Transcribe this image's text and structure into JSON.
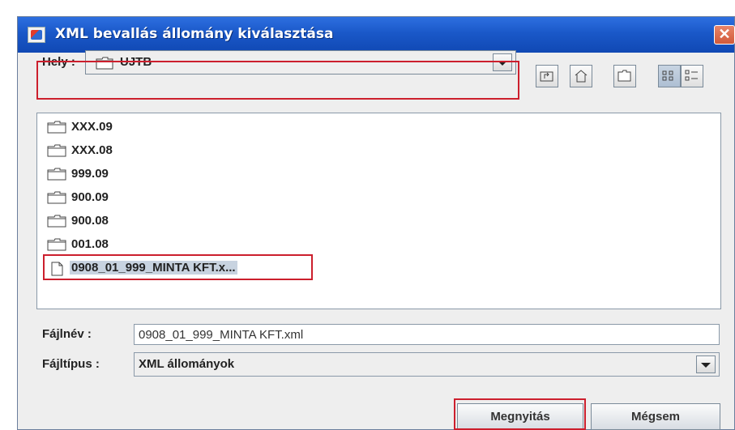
{
  "window": {
    "title": "XML bevallás állomány kiválasztása",
    "close_symbol": "✕"
  },
  "look_in": {
    "label": "Hely :",
    "value": "UJTB"
  },
  "toolbar": {
    "buttons": [
      "up-one-level-icon",
      "home-icon",
      "new-folder-icon",
      "list-view-icon",
      "details-view-icon"
    ]
  },
  "file_list": {
    "items": [
      {
        "name": "XXX.09",
        "type": "folder"
      },
      {
        "name": "XXX.08",
        "type": "folder"
      },
      {
        "name": "999.09",
        "type": "folder"
      },
      {
        "name": "900.09",
        "type": "folder"
      },
      {
        "name": "900.08",
        "type": "folder"
      },
      {
        "name": "001.08",
        "type": "folder"
      },
      {
        "name": "0908_01_999_MINTA KFT.x...",
        "type": "file",
        "selected": true
      }
    ]
  },
  "file_name": {
    "label": "Fájlnév :",
    "value": "0908_01_999_MINTA KFT.xml"
  },
  "file_type": {
    "label": "Fájltípus :",
    "value": "XML állományok"
  },
  "buttons": {
    "open": "Megnyitás",
    "cancel": "Mégsem"
  }
}
